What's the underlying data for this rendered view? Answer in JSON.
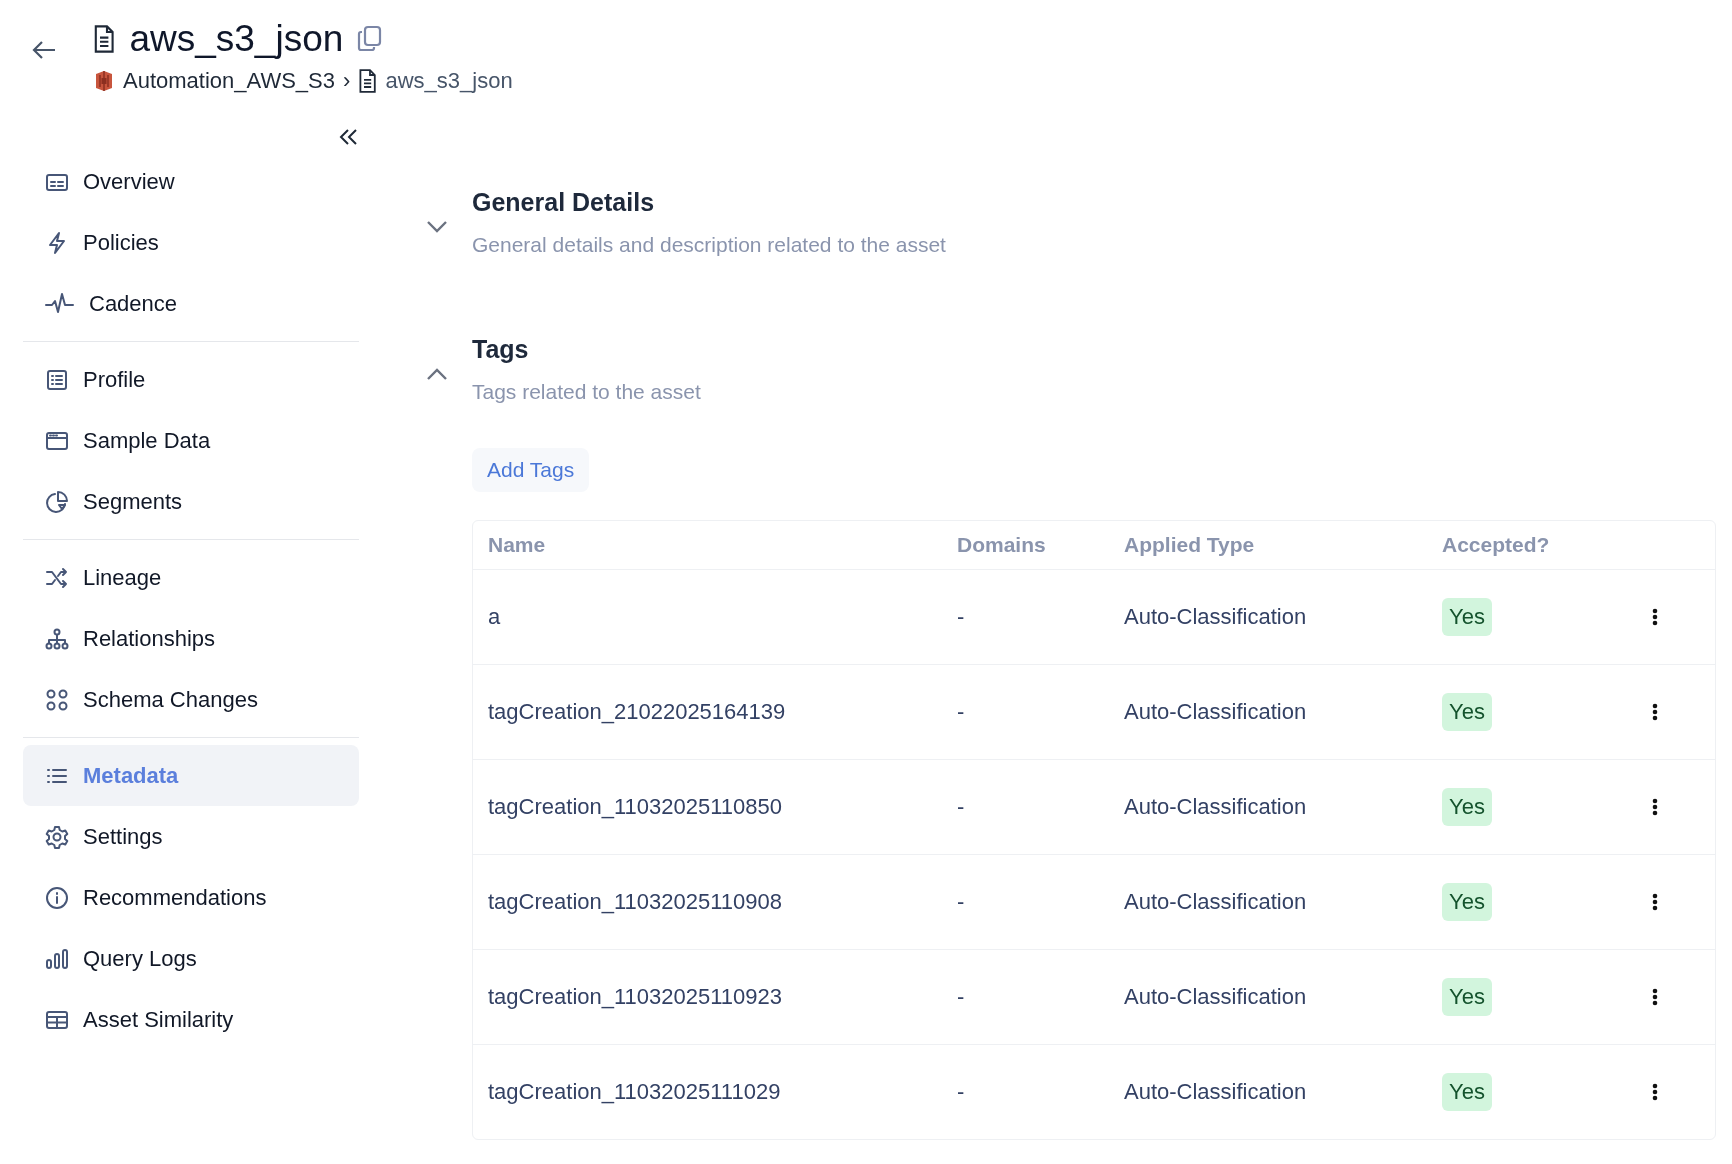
{
  "header": {
    "title": "aws_s3_json",
    "separator": "›",
    "breadcrumb": [
      {
        "label": "Automation_AWS_S3",
        "kind": "bucket"
      },
      {
        "label": "aws_s3_json",
        "kind": "file"
      }
    ]
  },
  "sidebar": {
    "groups": [
      {
        "items": [
          {
            "label": "Overview",
            "kind": "overview",
            "selected": false
          },
          {
            "label": "Policies",
            "kind": "policies",
            "selected": false
          },
          {
            "label": "Cadence",
            "kind": "cadence",
            "selected": false
          }
        ]
      },
      {
        "items": [
          {
            "label": "Profile",
            "kind": "profile",
            "selected": false
          },
          {
            "label": "Sample Data",
            "kind": "sample",
            "selected": false
          },
          {
            "label": "Segments",
            "kind": "segments",
            "selected": false
          }
        ]
      },
      {
        "items": [
          {
            "label": "Lineage",
            "kind": "lineage",
            "selected": false
          },
          {
            "label": "Relationships",
            "kind": "relationships",
            "selected": false
          },
          {
            "label": "Schema Changes",
            "kind": "schema",
            "selected": false
          }
        ]
      },
      {
        "items": [
          {
            "label": "Metadata",
            "kind": "metadata",
            "selected": true
          },
          {
            "label": "Settings",
            "kind": "settings",
            "selected": false
          },
          {
            "label": "Recommendations",
            "kind": "recommendations",
            "selected": false
          },
          {
            "label": "Query Logs",
            "kind": "querylogs",
            "selected": false
          },
          {
            "label": "Asset Similarity",
            "kind": "similarity",
            "selected": false
          }
        ]
      }
    ]
  },
  "sections": [
    {
      "title": "General Details",
      "subtitle": "General details and description related to the asset",
      "expanded": false
    },
    {
      "title": "Tags",
      "subtitle": "Tags related to the asset",
      "expanded": true,
      "button": "Add Tags",
      "table": {
        "columns": [
          "Name",
          "Domains",
          "Applied Type",
          "Accepted?"
        ],
        "rows": [
          {
            "name": "a",
            "domains": "-",
            "applied_type": "Auto-Classification",
            "accepted": "Yes"
          },
          {
            "name": "tagCreation_21022025164139",
            "domains": "-",
            "applied_type": "Auto-Classification",
            "accepted": "Yes"
          },
          {
            "name": "tagCreation_11032025110850",
            "domains": "-",
            "applied_type": "Auto-Classification",
            "accepted": "Yes"
          },
          {
            "name": "tagCreation_11032025110908",
            "domains": "-",
            "applied_type": "Auto-Classification",
            "accepted": "Yes"
          },
          {
            "name": "tagCreation_11032025110923",
            "domains": "-",
            "applied_type": "Auto-Classification",
            "accepted": "Yes"
          },
          {
            "name": "tagCreation_11032025111029",
            "domains": "-",
            "applied_type": "Auto-Classification",
            "accepted": "Yes"
          }
        ]
      }
    }
  ]
}
